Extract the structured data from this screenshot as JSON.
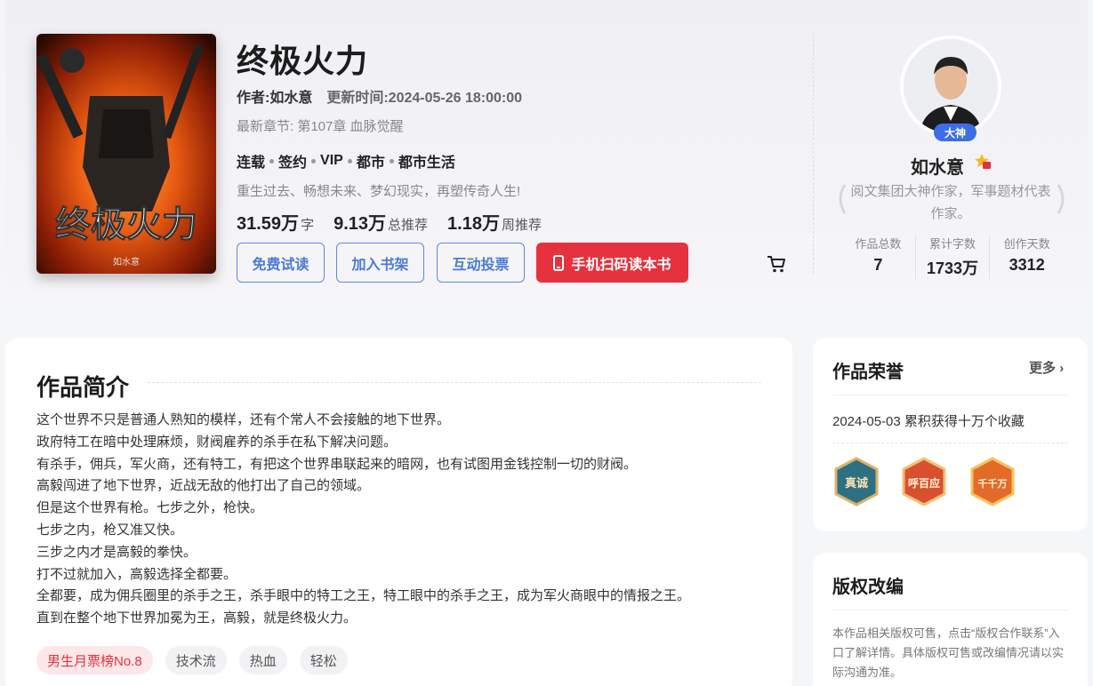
{
  "book": {
    "title": "终极火力",
    "cover_title": "终极火力",
    "cover_author": "如水意",
    "author_label": "作者:如水意",
    "updated_label": "更新时间:2024-05-26 18:00:00",
    "latest_chapter": "最新章节: 第107章 血脉觉醒",
    "tags": [
      "连载",
      "签约",
      "VIP",
      "都市",
      "都市生活"
    ],
    "slogan": "重生过去、畅想未来、梦幻现实，再塑传奇人生!",
    "stats": [
      {
        "num": "31.59万",
        "unit": "字"
      },
      {
        "num": "9.13万",
        "unit": "总推荐"
      },
      {
        "num": "1.18万",
        "unit": "周推荐"
      }
    ],
    "buttons": {
      "trial": "免费试读",
      "shelf": "加入书架",
      "vote": "互动投票",
      "scan": "手机扫码读本书"
    }
  },
  "author": {
    "badge": "大神",
    "name": "如水意",
    "desc": "阅文集团大神作家，军事题材代表作家。",
    "stats": [
      {
        "label": "作品总数",
        "value": "7"
      },
      {
        "label": "累计字数",
        "value": "1733万"
      },
      {
        "label": "创作天数",
        "value": "3312"
      }
    ]
  },
  "intro": {
    "title": "作品简介",
    "lines": [
      "这个世界不只是普通人熟知的模样，还有个常人不会接触的地下世界。",
      "政府特工在暗中处理麻烦，财阀雇养的杀手在私下解决问题。",
      "有杀手，佣兵，军火商，还有特工，有把这个世界串联起来的暗网，也有试图用金钱控制一切的财阀。",
      "高毅闯进了地下世界，近战无敌的他打出了自己的领域。",
      "但是这个世界有枪。七步之外，枪快。",
      "七步之内，枪又准又快。",
      "三步之内才是高毅的拳快。",
      "打不过就加入，高毅选择全都要。",
      "全都要，成为佣兵圈里的杀手之王，杀手眼中的特工之王，特工眼中的杀手之王，成为军火商眼中的情报之王。",
      "直到在整个地下世界加冕为王，高毅，就是终极火力。"
    ],
    "tags": [
      "男生月票榜No.8",
      "技术流",
      "热血",
      "轻松"
    ]
  },
  "honor": {
    "title": "作品荣誉",
    "more": "更多",
    "item": "2024-05-03 累积获得十万个收藏",
    "medals": [
      "真诚",
      "呼百应",
      "千千万"
    ]
  },
  "copyright": {
    "title": "版权改编",
    "text": "本作品相关版权可售，点击“版权合作联系”入口了解详情。具体版权可售或改编情况请以实际沟通为准。"
  },
  "colors": {
    "accent_blue": "#4b7ad8",
    "accent_red": "#e5323e"
  }
}
